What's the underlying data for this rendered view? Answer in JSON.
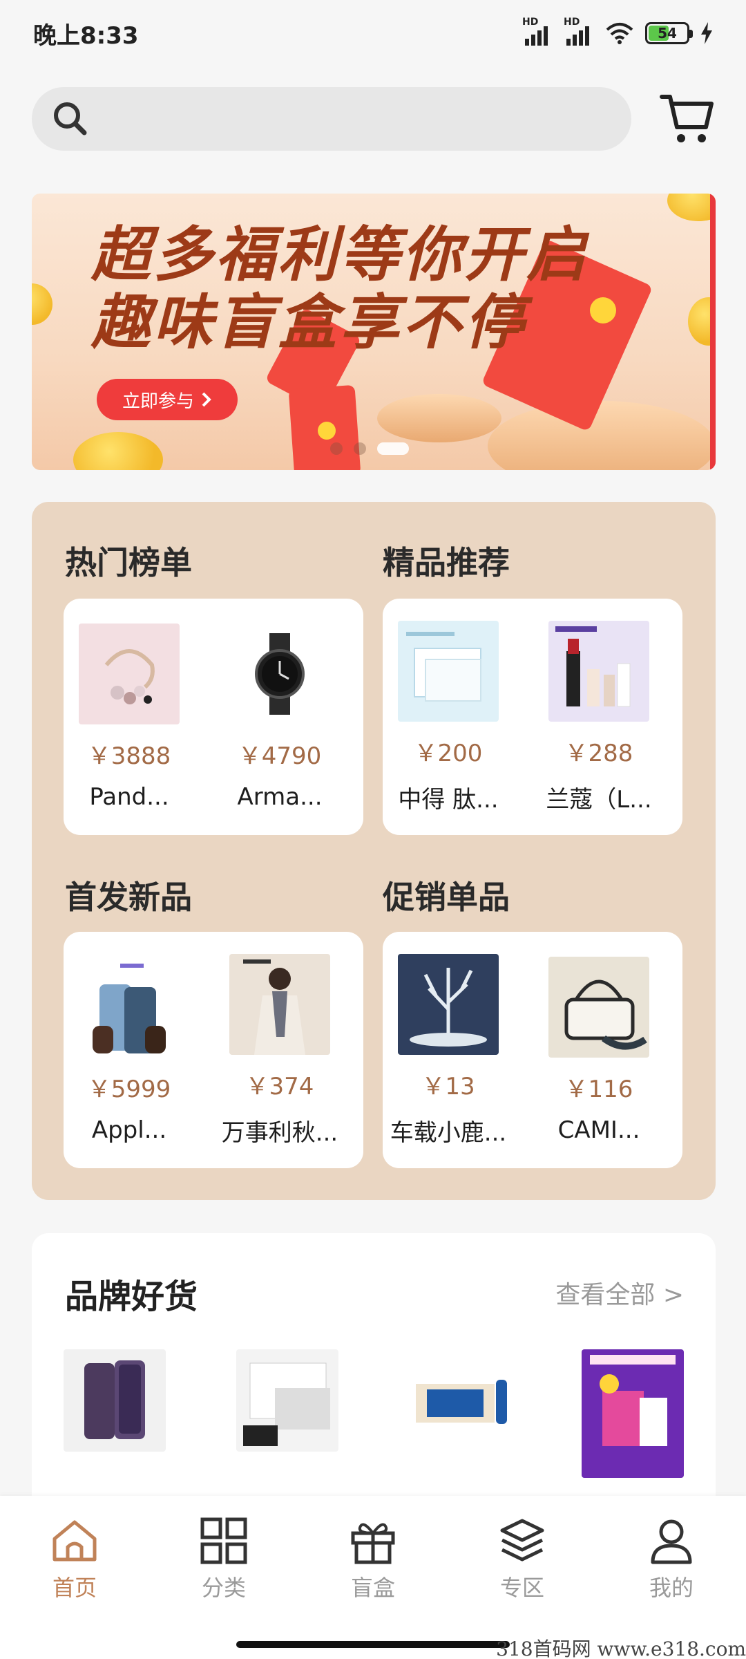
{
  "status_bar": {
    "time": "晚上8:33",
    "battery": "54",
    "hd1": "HD",
    "hd2": "HD"
  },
  "search": {
    "placeholder": ""
  },
  "banner": {
    "line1": "超多福利等你开启",
    "line2": "趣味盲盒享不停",
    "cta": "立即参与",
    "page_count": 3,
    "active_page": 3
  },
  "sections": [
    {
      "title": "热门榜单",
      "products": [
        {
          "price": "￥3888",
          "name": "Pand..."
        },
        {
          "price": "￥4790",
          "name": "Arma..."
        }
      ]
    },
    {
      "title": "精品推荐",
      "products": [
        {
          "price": "￥200",
          "name": "中得 肽..."
        },
        {
          "price": "￥288",
          "name": "兰蔻（L..."
        }
      ]
    },
    {
      "title": "首发新品",
      "products": [
        {
          "price": "￥5999",
          "name": "Appl..."
        },
        {
          "price": "￥374",
          "name": "万事利秋..."
        }
      ]
    },
    {
      "title": "促销单品",
      "products": [
        {
          "price": "￥13",
          "name": "车载小鹿..."
        },
        {
          "price": "￥116",
          "name": "CAMI..."
        }
      ]
    }
  ],
  "brand": {
    "title": "品牌好货",
    "view_all": "查看全部 >"
  },
  "nav": [
    {
      "label": "首页",
      "icon": "home-icon",
      "active": true
    },
    {
      "label": "分类",
      "icon": "grid-icon"
    },
    {
      "label": "盲盒",
      "icon": "gift-icon"
    },
    {
      "label": "专区",
      "icon": "layers-icon"
    },
    {
      "label": "我的",
      "icon": "user-icon"
    }
  ],
  "watermark": "318首码网  www.e318.com",
  "colors": {
    "accent": "#c08258",
    "price": "#a26a46",
    "category_bg": "#ead6c2",
    "banner_text": "#9d3a17",
    "cta": "#ef3c3c"
  }
}
